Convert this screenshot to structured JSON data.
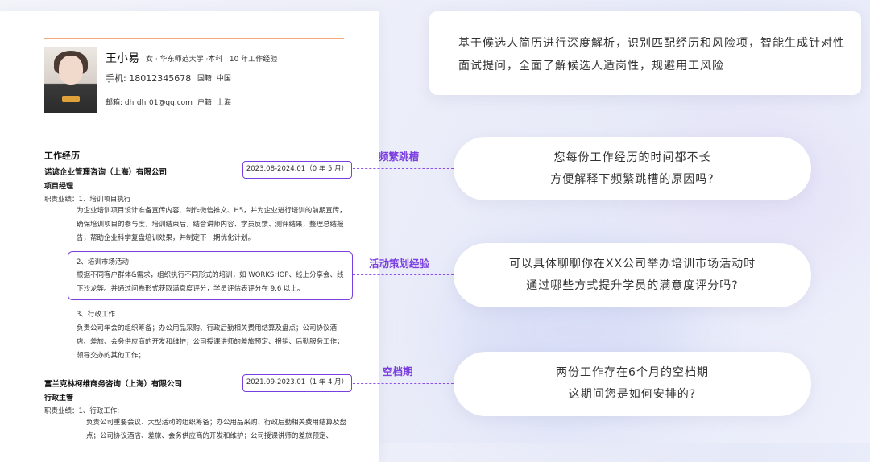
{
  "resume": {
    "name": "王小易",
    "meta": "女  ·  华东师范大学  ·本科 · 10 年工作经验",
    "phone": "手机: 18012345678",
    "nationality": "国籍: 中国",
    "email": "邮箱: dhrdhr01@qq.com",
    "hukou": "户籍: 上海",
    "section_title": "工作经历",
    "jobs": [
      {
        "company": "诺谚企业管理咨询（上海）有限公司",
        "date": "2023.08-2024.01（0 年 5 月）",
        "role": "项目经理",
        "duties_label": "职责业绩：1、培训项目执行",
        "item1_text": "为企业培训项目设计准备宣传内容、制作微信推文、H5，并为企业进行培训的前期宣传，确保培训项目的参与度，培训结束后，结合讲师内容、学员反馈、测评结果，整理总结报告，帮助企业科学复盘培训效果，并制定下一期优化计划。",
        "item2_title": "2、培训市场活动",
        "item2_text": "根据不同客户群体&需求，组织执行不同形式的培训，如 WORKSHOP、线上分享会、线下沙龙等。并通过问卷形式获取满意度评分，学员评估表评分在 9.6 以上。",
        "item3_title": "3、行政工作",
        "item3_text": "负责公司年会的组织筹备；办公用品采购、行政后勤相关费用结算及盘点；公司协议酒店、差旅、会务供应商的开发和维护；公司授课讲师的差旅预定、报销、后勤服务工作；领导交办的其他工作；"
      },
      {
        "company": "富兰克林柯维商务咨询（上海）有限公司",
        "date": "2021.09-2023.01（1 年 4 月）",
        "role": "行政主管",
        "duties_label": "职责业绩：1、行政工作:",
        "item1_text": "负责公司重要会议、大型活动的组织筹备；办公用品采购、行政后勤相关费用结算及盘点；公司协议酒店、差旅、会务供应商的开发和维护；公司授课讲师的差旅预定、"
      }
    ]
  },
  "tags": {
    "frequent": "频繁跳槽",
    "activity": "活动策划经验",
    "gap": "空档期"
  },
  "intro_text": "基于候选人简历进行深度解析，识别匹配经历和风险项，智能生成针对性面试提问，全面了解候选人适岗性，规避用工风险",
  "questions": [
    {
      "line1": "您每份工作经历的时间都不长",
      "line2": "方便解释下频繁跳槽的原因吗?"
    },
    {
      "line1": "可以具体聊聊你在XX公司举办培训市场活动时",
      "line2": "通过哪些方式提升学员的满意度评分吗?"
    },
    {
      "line1": "两份工作存在6个月的空档期",
      "line2": "这期间您是如何安排的?"
    }
  ],
  "colors": {
    "accent": "#7b3fe0",
    "orange_line": "#f0aa7c"
  }
}
